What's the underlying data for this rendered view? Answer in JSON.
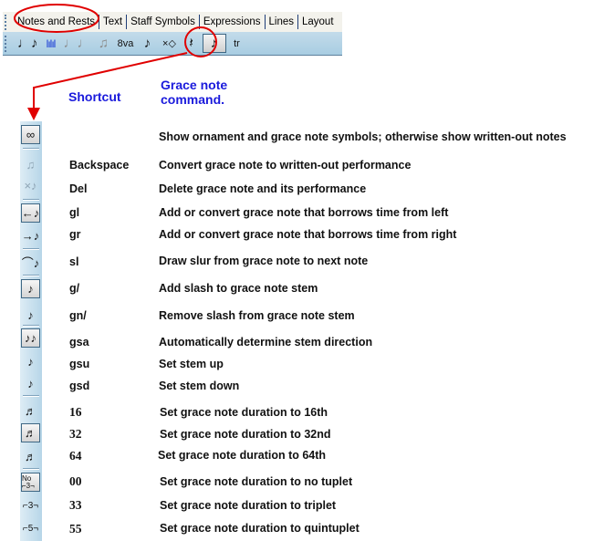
{
  "tabs": [
    "Notes and Rests",
    "Text",
    "Staff Symbols",
    "Expressions",
    "Lines",
    "Layout"
  ],
  "toolbar_icons": [
    {
      "name": "notes-icon",
      "glyph": "♩♪"
    },
    {
      "name": "bars-icon",
      "glyph": "lılıl"
    },
    {
      "name": "tie-icon",
      "glyph": "♩♩"
    },
    {
      "name": "beam-icon",
      "glyph": "♫"
    },
    {
      "name": "octave-icon",
      "glyph": "8va"
    },
    {
      "name": "arpeggio-icon",
      "glyph": "♪"
    },
    {
      "name": "notehead-icon",
      "glyph": "×◇"
    },
    {
      "name": "rest-icon",
      "glyph": "𝄽"
    },
    {
      "name": "grace-note-icon",
      "glyph": "♪"
    },
    {
      "name": "ornament-icon",
      "glyph": "tr"
    }
  ],
  "header": {
    "shortcut": "Shortcut",
    "command_line1": "Grace note",
    "command_line2": "command."
  },
  "colors": {
    "accent_blue": "#1a1adc",
    "annotation_red": "#e00000"
  },
  "rows": [
    {
      "icon": "ornament-toggle-icon",
      "glyph": "∞",
      "shortcut": "",
      "desc": "Show ornament and grace note symbols; otherwise show written-out notes"
    },
    {
      "icon": "convert-performance-icon",
      "glyph": "♫",
      "shortcut": "Backspace",
      "desc": "Convert grace note to written-out performance"
    },
    {
      "icon": "delete-grace-icon",
      "glyph": "×♪",
      "shortcut": "Del",
      "desc": "Delete grace note and its performance"
    },
    {
      "icon": "borrow-left-icon",
      "glyph": "←♪",
      "shortcut": "gl",
      "desc": "Add or convert grace note that borrows time from left"
    },
    {
      "icon": "borrow-right-icon",
      "glyph": "→♪",
      "shortcut": "gr",
      "desc": "Add or convert grace note that borrows time from right"
    },
    {
      "icon": "slur-icon",
      "glyph": "⌒♪",
      "shortcut": "sl",
      "desc": "Draw slur from grace note to next note"
    },
    {
      "icon": "add-slash-icon",
      "glyph": "♪",
      "shortcut": "g/",
      "desc": "Add slash to grace note stem"
    },
    {
      "icon": "remove-slash-icon",
      "glyph": "♪",
      "shortcut": "gn/",
      "desc": "Remove slash from grace note stem"
    },
    {
      "icon": "stem-auto-icon",
      "glyph": "♪♪",
      "shortcut": "gsa",
      "desc": "Automatically determine stem direction"
    },
    {
      "icon": "stem-up-icon",
      "glyph": "♪",
      "shortcut": "gsu",
      "desc": "Set stem up"
    },
    {
      "icon": "stem-down-icon",
      "glyph": "♪",
      "shortcut": "gsd",
      "desc": "Set stem down"
    },
    {
      "icon": "duration-16th-icon",
      "glyph": "♬",
      "shortcut": "16",
      "desc": "Set grace note duration to 16th"
    },
    {
      "icon": "duration-32nd-icon",
      "glyph": "♬",
      "shortcut": "32",
      "desc": "Set grace note duration to 32nd"
    },
    {
      "icon": "duration-64th-icon",
      "glyph": "♬",
      "shortcut": "64",
      "desc": "Set grace note duration to 64th"
    },
    {
      "icon": "no-tuplet-icon",
      "glyph": "No ⌐3¬",
      "shortcut": "00",
      "desc": "Set grace note duration to no tuplet"
    },
    {
      "icon": "triplet-icon",
      "glyph": "⌐3¬",
      "shortcut": "33",
      "desc": "Set grace note duration to triplet"
    },
    {
      "icon": "quintuplet-icon",
      "glyph": "⌐5¬",
      "shortcut": "55",
      "desc": "Set grace note duration to quintuplet"
    }
  ]
}
